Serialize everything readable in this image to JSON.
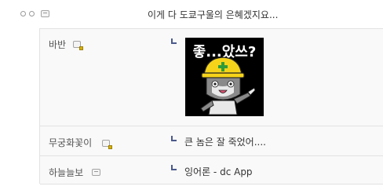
{
  "comment": {
    "text": "이게 다 도쿄구울의 은혜겠지요..."
  },
  "replies": [
    {
      "nick": "바반",
      "sticker_caption": "좋...았쓰?"
    },
    {
      "nick": "무궁화꽃이",
      "text": "큰 놈은 잘 죽었어...."
    },
    {
      "nick": "하늘늘보",
      "text": "잉어론 - dc App"
    }
  ],
  "colors": {
    "reply_bg": "#f9f9f9",
    "border": "#e2e2e2",
    "arrow": "#4a5a8c",
    "helmet": "#f5d31a"
  }
}
